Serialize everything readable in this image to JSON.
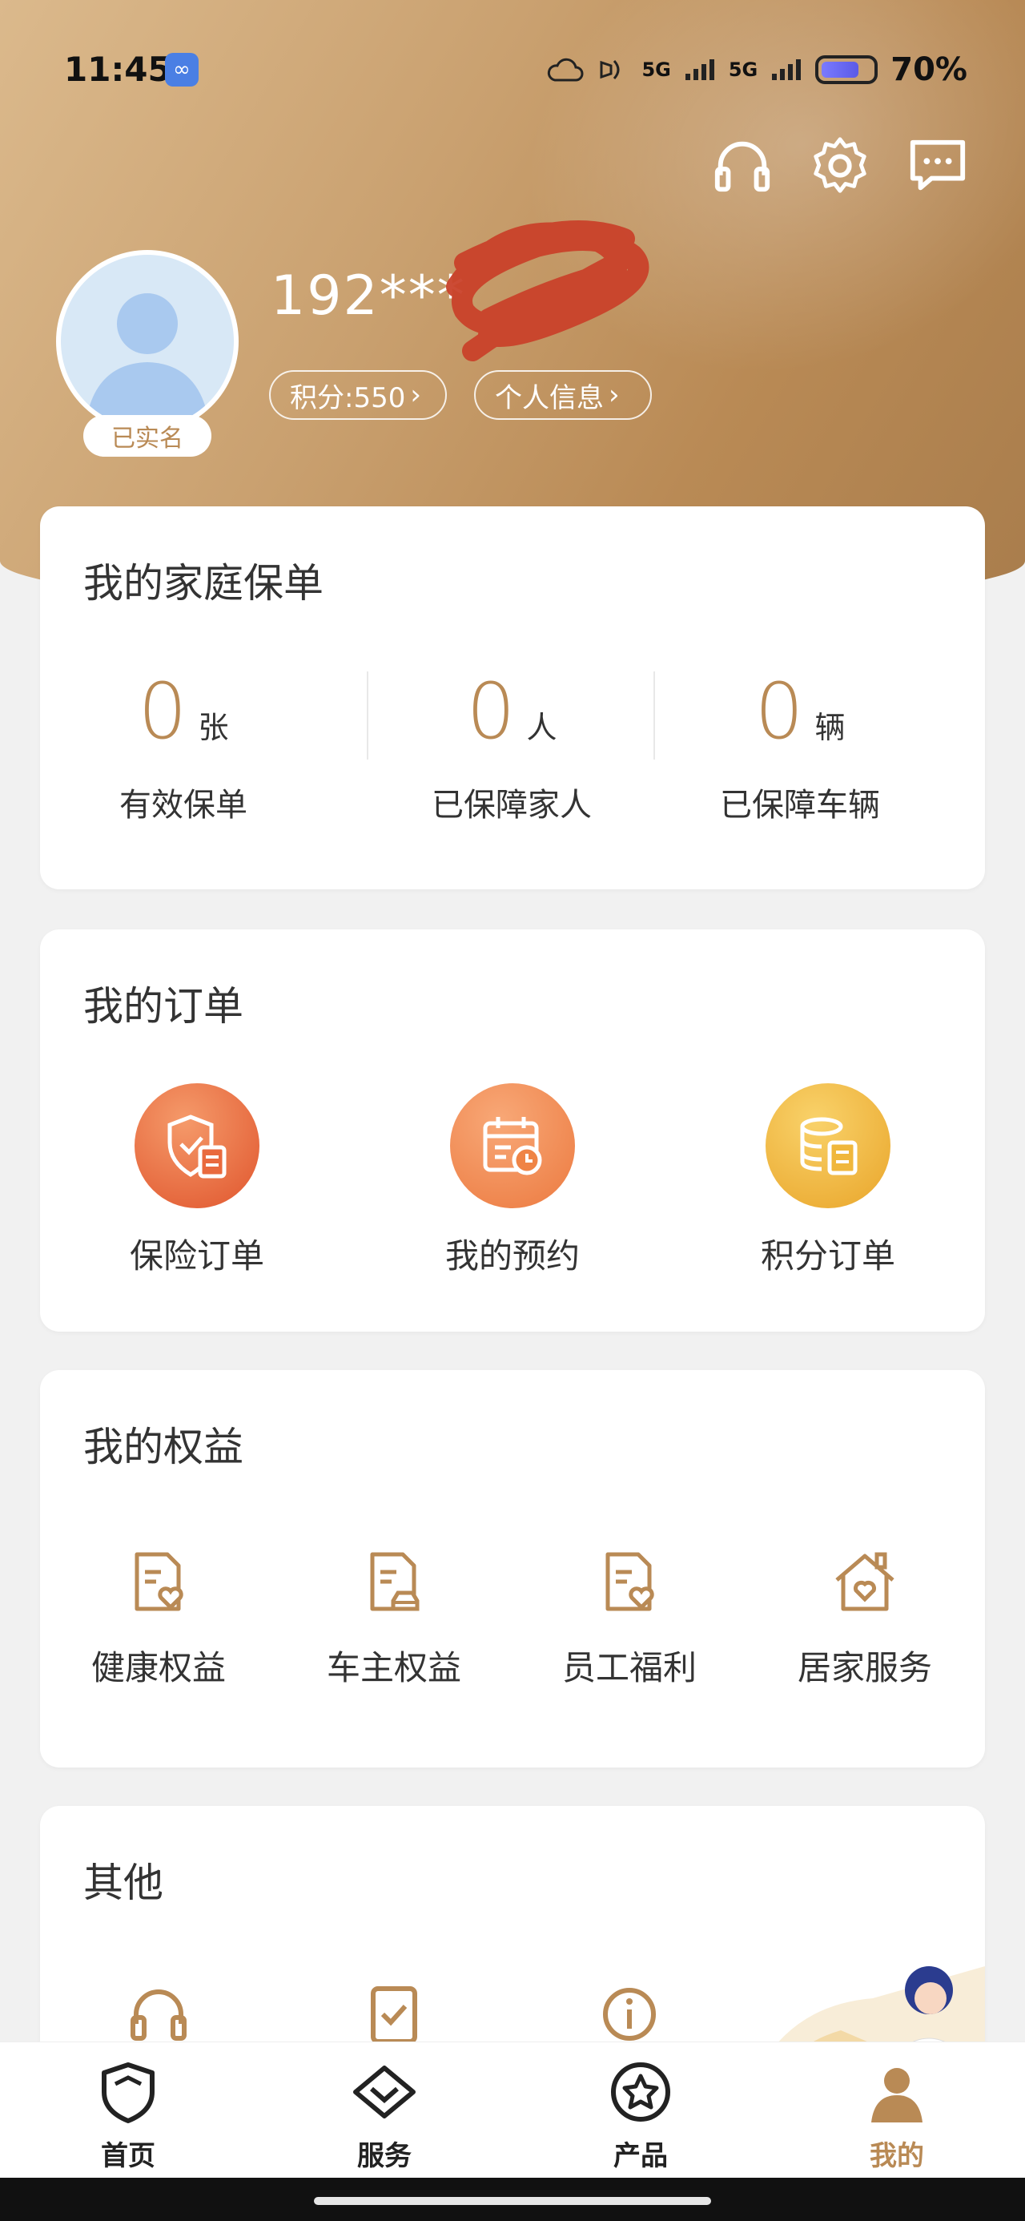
{
  "status_bar": {
    "time": "11:45",
    "link_icon": "link-icon",
    "signal_1": "5G",
    "signal_2": "5G",
    "battery": "70%"
  },
  "header": {
    "icons": [
      "headset-icon",
      "gear-icon",
      "message-icon"
    ],
    "username": "192***",
    "verified_label": "已实名",
    "points_label": "积分:550",
    "profile_label": "个人信息"
  },
  "policy": {
    "title": "我的家庭保单",
    "stats": [
      {
        "value": "0",
        "unit": "张",
        "label": "有效保单"
      },
      {
        "value": "0",
        "unit": "人",
        "label": "已保障家人"
      },
      {
        "value": "0",
        "unit": "辆",
        "label": "已保障车辆"
      }
    ]
  },
  "orders": {
    "title": "我的订单",
    "items": [
      {
        "label": "保险订单",
        "icon": "shield-doc-icon",
        "color": "#e86a3c"
      },
      {
        "label": "我的预约",
        "icon": "calendar-clock-icon",
        "color": "#f08a4b"
      },
      {
        "label": "积分订单",
        "icon": "coin-doc-icon",
        "color": "#efb02e"
      }
    ]
  },
  "rights": {
    "title": "我的权益",
    "items": [
      {
        "label": "健康权益",
        "icon": "health-doc-icon"
      },
      {
        "label": "车主权益",
        "icon": "car-doc-icon"
      },
      {
        "label": "员工福利",
        "icon": "welfare-doc-icon"
      },
      {
        "label": "居家服务",
        "icon": "home-heart-icon"
      }
    ]
  },
  "other": {
    "title": "其他",
    "icons": [
      "headset-icon",
      "check-doc-icon",
      "info-icon"
    ]
  },
  "nav": {
    "items": [
      {
        "label": "首页",
        "icon": "shield-home-icon"
      },
      {
        "label": "服务",
        "icon": "diamond-check-icon"
      },
      {
        "label": "产品",
        "icon": "star-circle-icon"
      },
      {
        "label": "我的",
        "icon": "person-icon"
      }
    ],
    "active_color": "#b98a55"
  },
  "colors": {
    "accent": "#b98a55",
    "header_gradient_start": "#dbb98c",
    "header_gradient_end": "#a97d4c"
  }
}
